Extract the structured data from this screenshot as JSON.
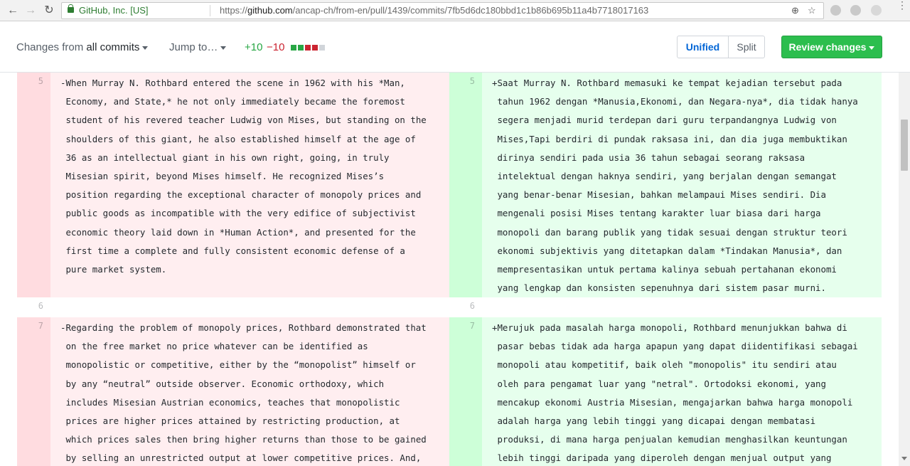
{
  "browser": {
    "back_glyph": "←",
    "forward_glyph": "→",
    "reload_glyph": "↻",
    "secure_label": "GitHub, Inc. [US]",
    "url_scheme": "https://",
    "url_host": "github.com",
    "url_path": "/ancap-ch/from-en/pull/1439/commits/7fb5d6dc180bbd1c1b86b695b11a4b7718017163",
    "zoom_glyph": "⊕",
    "bookmark_glyph": "☆",
    "menu_glyph": "⋮",
    "icons": [
      "back-icon",
      "forward-icon",
      "reload-icon",
      "lock-icon",
      "zoom-icon",
      "bookmark-star-icon",
      "extension-icon",
      "menu-icon"
    ]
  },
  "toolbar": {
    "changes_from_prefix": "Changes from",
    "changes_from_value": "all commits",
    "jump_to": "Jump to…",
    "additions": "+10",
    "deletions": "−10",
    "diffstat_blocks": [
      "add",
      "add",
      "del",
      "del",
      "neutral"
    ],
    "view_unified": "Unified",
    "view_split": "Split",
    "review_changes": "Review changes",
    "colors": {
      "addition": "#28a745",
      "deletion": "#cb2431",
      "neutral": "#d1d5da",
      "review_bg": "#2cbe4e",
      "unified": "#0366d6"
    }
  },
  "diff": {
    "hunks": [
      {
        "type": "change",
        "left_line": "5",
        "right_line": "5",
        "left_lines": [
          "-When Murray N. Rothbard entered the scene in 1962 with his *Man,",
          " Economy, and State,* he not only immediately became the foremost",
          " student of his revered teacher Ludwig von Mises, but standing on the",
          " shoulders of this giant, he also established himself at the age of",
          " 36 as an intellectual giant in his own right, going, in truly",
          " Misesian spirit, beyond Mises himself. He recognized Mises’s",
          " position regarding the exceptional character of monopoly prices and",
          " public goods as incompatible with the very edifice of subjectivist",
          " economic theory laid down in *Human Action*, and presented for the",
          " first time a complete and fully consistent economic defense of a",
          " pure market system."
        ],
        "right_lines": [
          "+Saat Murray N. Rothbard memasuki ke tempat kejadian tersebut pada",
          " tahun 1962 dengan *Manusia,Ekonomi, dan Negara-nya*, dia tidak hanya",
          " segera menjadi murid terdepan dari guru terpandangnya Ludwig von",
          " Mises,Tapi berdiri di pundak raksasa ini, dan dia juga membuktikan",
          " dirinya sendiri pada usia 36 tahun sebagai seorang raksasa",
          " intelektual dengan haknya sendiri, yang berjalan dengan semangat",
          " yang benar-benar Misesian, bahkan melampaui Mises sendiri. Dia",
          " mengenali posisi Mises tentang karakter luar biasa dari harga",
          " monopoli dan barang publik yang tidak sesuai dengan struktur teori",
          " ekonomi subjektivis yang ditetapkan dalam *Tindakan Manusia*, dan",
          " mempresentasikan untuk pertama kalinya sebuah pertahanan ekonomi",
          " yang lengkap dan konsisten sepenuhnya dari sistem pasar murni."
        ]
      },
      {
        "type": "context",
        "left_line": "6",
        "right_line": "6",
        "left_lines": [
          ""
        ],
        "right_lines": [
          ""
        ]
      },
      {
        "type": "change",
        "left_line": "7",
        "right_line": "7",
        "left_lines": [
          "-Regarding the problem of monopoly prices, Rothbard demonstrated that",
          " on the free market no price whatever can be identified as",
          " monopolistic or competitive, either by the “monopolist” himself or",
          " by any “neutral” outside observer. Economic orthodoxy, which",
          " includes Misesian Austrian economics, teaches that monopolistic",
          " prices are higher prices attained by restricting production, at",
          " which prices sales then bring higher returns than those to be gained",
          " by selling an unrestricted output at lower competitive prices. And,"
        ],
        "right_lines": [
          "+Merujuk pada masalah harga monopoli, Rothbard menunjukkan bahwa di",
          " pasar bebas tidak ada harga apapun yang dapat diidentifikasi sebagai",
          " monopoli atau kompetitif, baik oleh \"monopolis\" itu sendiri atau",
          " oleh para pengamat luar yang \"netral\". Ortodoksi ekonomi, yang",
          " mencakup ekonomi Austria Misesian, mengajarkan bahwa harga monopoli",
          " adalah harga yang lebih tinggi yang dicapai dengan membatasi",
          " produksi, di mana harga penjualan kemudian menghasilkan keuntungan",
          " lebih tinggi daripada yang diperoleh dengan menjual output yang"
        ]
      }
    ]
  }
}
